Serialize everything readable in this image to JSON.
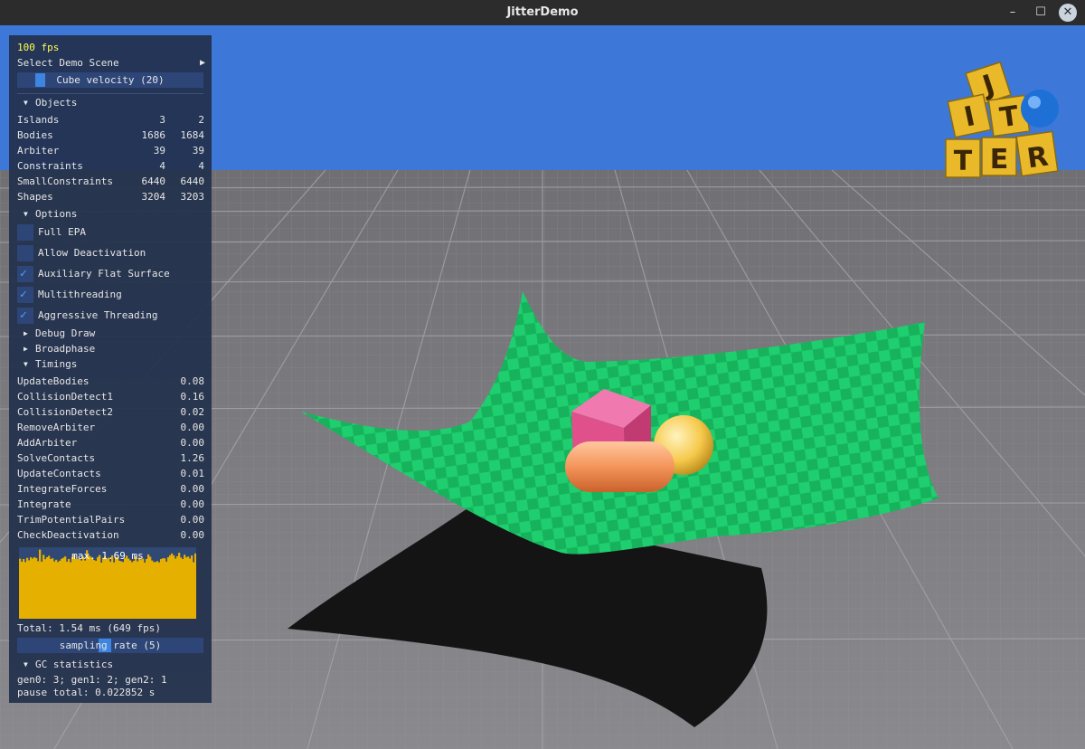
{
  "window": {
    "title": "JitterDemo",
    "minimize": "–",
    "maximize": "☐",
    "close": "✕"
  },
  "panel": {
    "fps": "100 fps",
    "select_scene": "Select Demo Scene",
    "select_arrow": "▶",
    "cube_velocity": "Cube velocity (20)",
    "cube_velocity_value": 20,
    "objects_header": "Objects",
    "objects": [
      {
        "label": "Islands",
        "a": "3",
        "b": "2"
      },
      {
        "label": "Bodies",
        "a": "1686",
        "b": "1684"
      },
      {
        "label": "Arbiter",
        "a": "39",
        "b": "39"
      },
      {
        "label": "Constraints",
        "a": "4",
        "b": "4"
      },
      {
        "label": "SmallConstraints",
        "a": "6440",
        "b": "6440"
      },
      {
        "label": "Shapes",
        "a": "3204",
        "b": "3203"
      }
    ],
    "options_header": "Options",
    "options": [
      {
        "label": "Full EPA",
        "checked": false
      },
      {
        "label": "Allow Deactivation",
        "checked": false
      },
      {
        "label": "Auxiliary Flat Surface",
        "checked": true
      },
      {
        "label": "Multithreading",
        "checked": true
      },
      {
        "label": "Aggressive Threading",
        "checked": true
      }
    ],
    "debug_draw": "Debug Draw",
    "broadphase": "Broadphase",
    "timings_header": "Timings",
    "timings": [
      {
        "label": "UpdateBodies",
        "value": "0.08"
      },
      {
        "label": "CollisionDetect1",
        "value": "0.16"
      },
      {
        "label": "CollisionDetect2",
        "value": "0.02"
      },
      {
        "label": "RemoveArbiter",
        "value": "0.00"
      },
      {
        "label": "AddArbiter",
        "value": "0.00"
      },
      {
        "label": "SolveContacts",
        "value": "1.26"
      },
      {
        "label": "UpdateContacts",
        "value": "0.01"
      },
      {
        "label": "IntegrateForces",
        "value": "0.00"
      },
      {
        "label": "Integrate",
        "value": "0.00"
      },
      {
        "label": "TrimPotentialPairs",
        "value": "0.00"
      },
      {
        "label": "CheckDeactivation",
        "value": "0.00"
      }
    ],
    "histogram_label": "max. 1.69 ms",
    "total": "Total: 1.54 ms (649 fps)",
    "sampling_rate": "sampling rate (5)",
    "sampling_rate_value": 5,
    "gc_header": "GC statistics",
    "gc_gens": "gen0: 3; gen1: 2; gen2: 1",
    "gc_pause": "pause total: 0.022852 s"
  },
  "logo": {
    "letters": [
      "J",
      "I",
      "T",
      "T",
      "E",
      "R"
    ]
  },
  "colors": {
    "sky": "#3d78d8",
    "floor": "#7e7e82",
    "cloth": "#1fce6e",
    "cloth_dark": "#17b35c",
    "cube": "#e0508a",
    "capsule": "#f28a4f",
    "sphere": "#f6c94c",
    "histogram": "#e6b000",
    "panel": "#22304c"
  }
}
